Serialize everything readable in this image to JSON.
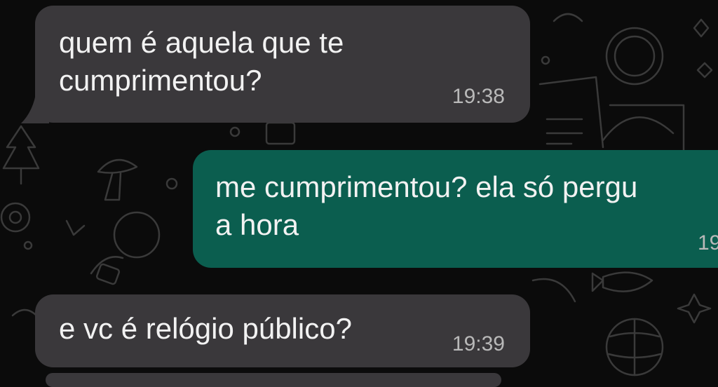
{
  "chat": {
    "messages": [
      {
        "direction": "incoming",
        "line1": "quem é aquela que te",
        "line2": "cumprimentou?",
        "time": "19:38"
      },
      {
        "direction": "outgoing",
        "line1": "me cumprimentou? ela só pergu",
        "line2": "a hora",
        "time": "19"
      },
      {
        "direction": "incoming",
        "line1": "e vc é relógio público?",
        "time": "19:39"
      }
    ]
  },
  "colors": {
    "background": "#0b0b0b",
    "incoming_bubble": "#3a383b",
    "outgoing_bubble": "#0b5e4f",
    "timestamp": "#b9b9b9"
  }
}
